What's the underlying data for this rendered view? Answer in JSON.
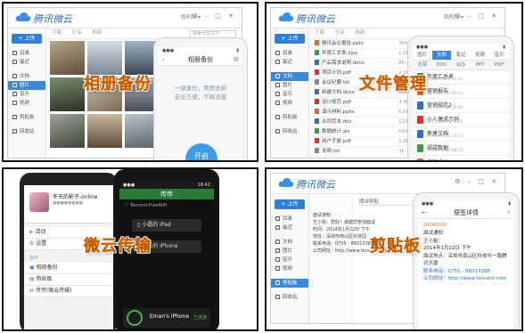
{
  "labels": {
    "album_backup": "相册备份",
    "file_manage": "文件管理",
    "weiyun_transfer": "微云传输",
    "clipboard": "剪贴板"
  },
  "desktop": {
    "brand": "腾讯微云",
    "user": "随和lei▾",
    "upload_button": "+ 上传",
    "search_placeholder": "搜索全部文件",
    "nav": [
      "目录",
      "最近",
      "文档",
      "图片",
      "音乐",
      "视频",
      "剪贴板",
      "回收站"
    ],
    "toolbar": [
      "下载",
      "分享",
      "刷新"
    ]
  },
  "album": {
    "phone_title": "相册备份",
    "phone_text": [
      "一键备份，原图无损",
      "安全方便，不耗流量"
    ],
    "phone_button": "开启"
  },
  "files": {
    "list": [
      {
        "name": "微讯会议报告.pptx",
        "size": "345.3K",
        "color": "#e8632a"
      },
      {
        "name": "年度汇总表.xlsx",
        "size": "1.2M",
        "color": "#3b9a4e"
      },
      {
        "name": "产品需求说明.docx",
        "size": "86.4K",
        "color": "#2f6fc4"
      },
      {
        "name": "项目计划.pdf",
        "size": "2.1M",
        "color": "#d9342b"
      },
      {
        "name": "会议纪要.txt",
        "size": "12K",
        "color": "#888888"
      },
      {
        "name": "新建文档.docx",
        "size": "45K",
        "color": "#2f6fc4"
      },
      {
        "name": "设计规范.pdf",
        "size": "3.4M",
        "color": "#d9342b"
      },
      {
        "name": "演示材料.pptx",
        "size": "5.6M",
        "color": "#e8632a"
      },
      {
        "name": "合同范本.doc",
        "size": "120K",
        "color": "#2f6fc4"
      },
      {
        "name": "数据统计.xls",
        "size": "640K",
        "color": "#3b9a4e"
      },
      {
        "name": "用户手册.pdf",
        "size": "1.8M",
        "color": "#d9342b"
      },
      {
        "name": "说明.txt",
        "size": "3K",
        "color": "#888888"
      }
    ],
    "phone_tabs": [
      "图片",
      "文档",
      "笔记",
      "视频",
      "音乐"
    ],
    "phone_filter": [
      "全部",
      "DOC",
      "XLS",
      "PPT",
      "PDF"
    ],
    "phone_docs": [
      {
        "title": "年度汇总表",
        "date": "2014-03-21 11:31",
        "color": "#3b9a4e"
      },
      {
        "title": "营销报告",
        "date": "2014-03-20 09:12",
        "color": "#e8632a"
      },
      {
        "title": "营销规范2",
        "date": "2014-03-18 16:40",
        "color": "#2f6fc4"
      },
      {
        "title": "小人偶求示例",
        "date": "2014-03-15 10:02",
        "color": "#d9342b"
      },
      {
        "title": "新建文档",
        "date": "2014-03-12 14:27",
        "color": "#2f6fc4"
      },
      {
        "title": "福袋数据",
        "date": "2014-03-10 08:55",
        "color": "#3b9a4e"
      },
      {
        "title": "演示设计",
        "date": "2014-03-08 19:30",
        "color": "#e8632a"
      }
    ]
  },
  "transfer": {
    "profile_name": "冬天的影子-online",
    "menu": [
      "活动",
      "设置"
    ],
    "section": "操作",
    "ops": [
      "相册备份",
      "剪贴板",
      "传传(微云传输)"
    ],
    "device_title": "传传",
    "wifi": "Tencent-FreeWifi",
    "devices": [
      "小磊的 iPad",
      "小磊的 iPhone"
    ],
    "bottom_device": "Eman's iPhone",
    "bottom_action": "已连接",
    "time": "18:42"
  },
  "clip": {
    "nav": [
      "目录",
      "最近",
      "文档",
      "图片",
      "音乐",
      "视频",
      "剪贴板",
      "回收站"
    ],
    "window_tab": "朗读剪贴",
    "text_lines": [
      "面试通知",
      "王小姐：您好！诚邀您参加面试",
      "时间：2014年1月22日 下午",
      "地址：深圳市南山区科技园",
      "联系电话：0755 - 86013388",
      "公司网址：http://www.tencent.com"
    ],
    "phone_title": "便签详情",
    "phone_lines": [
      "面试通知",
      "王小姐：",
      "2014年1月22日 下午",
      "面试地点：深圳市南山区科技中一路腾讯大厦",
      "联系电话：0755 - 86013388",
      "公司网址：http://www.foncent.com"
    ]
  }
}
